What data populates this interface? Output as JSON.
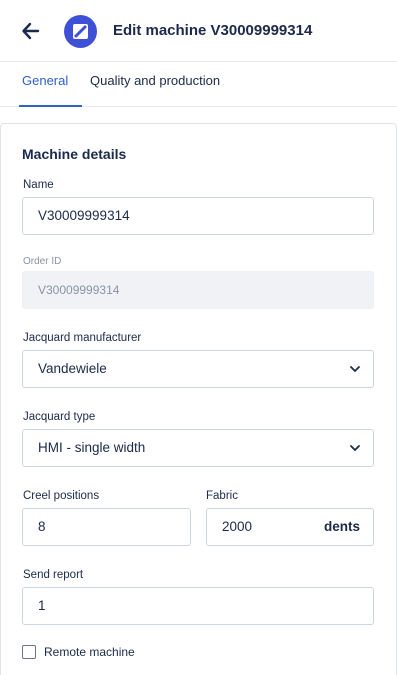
{
  "header": {
    "title": "Edit machine V30009999314",
    "back_icon": "arrow-left-icon",
    "logo_icon": "edit-pencil-icon",
    "accent_color": "#3d50d6"
  },
  "tabs": [
    {
      "label": "General",
      "active": true
    },
    {
      "label": "Quality and production",
      "active": false
    }
  ],
  "form": {
    "section_title": "Machine details",
    "name": {
      "label": "Name",
      "value": "V30009999314"
    },
    "order_id": {
      "label": "Order ID",
      "value": "V30009999314",
      "disabled": true
    },
    "jacquard_manufacturer": {
      "label": "Jacquard manufacturer",
      "value": "Vandewiele"
    },
    "jacquard_type": {
      "label": "Jacquard type",
      "value": "HMI - single width"
    },
    "creel_positions": {
      "label": "Creel positions",
      "value": "8"
    },
    "fabric": {
      "label": "Fabric",
      "value": "2000",
      "unit": "dents"
    },
    "send_report": {
      "label": "Send report",
      "value": "1"
    },
    "remote_machine": {
      "label": "Remote machine",
      "checked": false
    }
  }
}
